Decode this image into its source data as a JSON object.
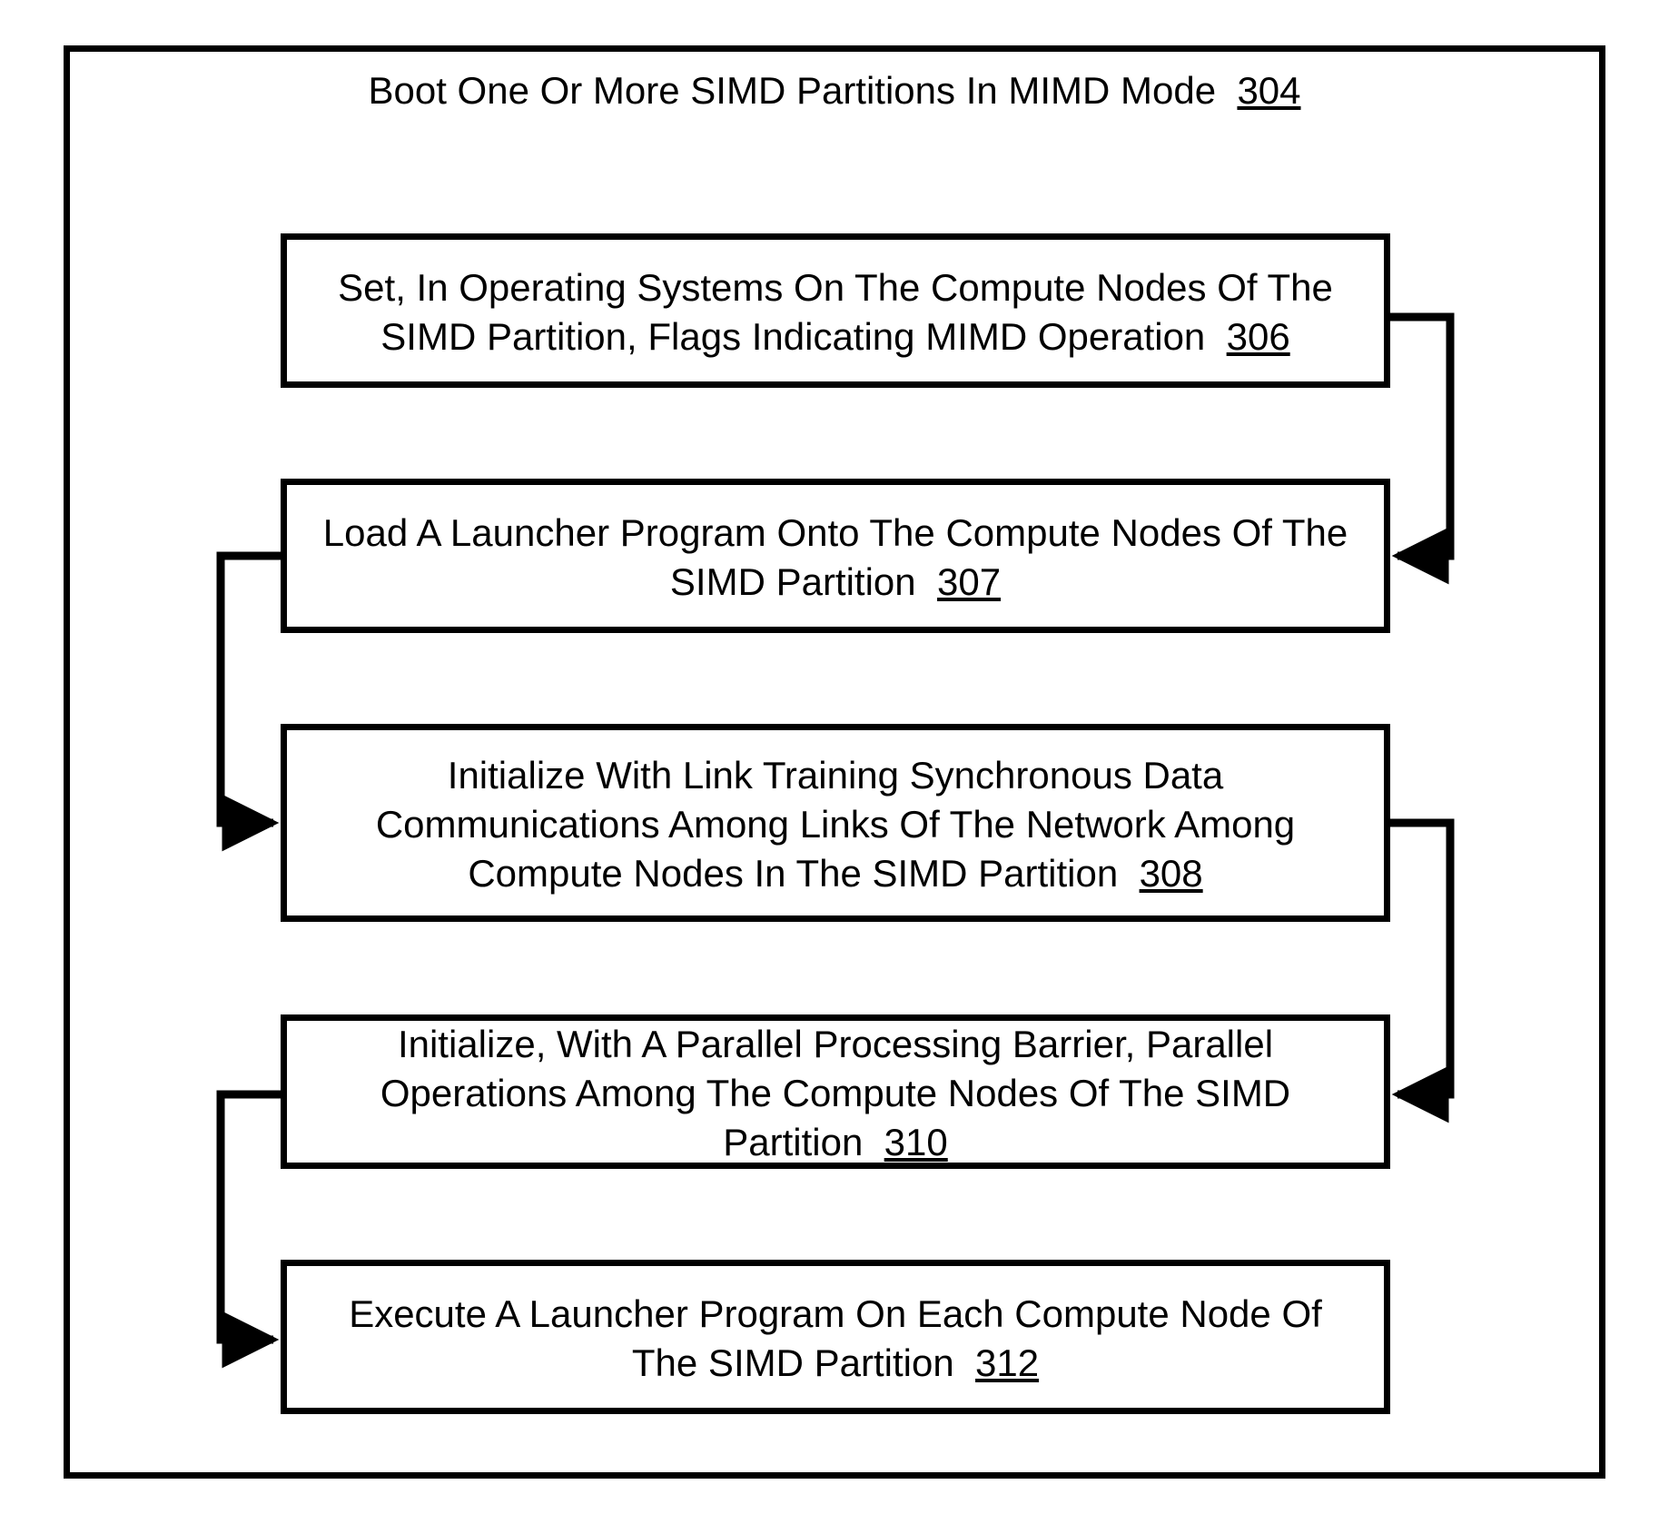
{
  "diagram": {
    "title_text": "Boot One Or More SIMD Partitions In MIMD Mode",
    "title_ref": "304",
    "steps": {
      "s306": {
        "text": "Set, In Operating Systems On The Compute Nodes Of The SIMD Partition, Flags Indicating MIMD Operation",
        "ref": "306"
      },
      "s307": {
        "text": "Load A Launcher Program Onto The Compute Nodes Of The SIMD Partition",
        "ref": "307"
      },
      "s308": {
        "text": "Initialize With Link Training Synchronous Data Communications Among Links Of The Network Among Compute Nodes In The SIMD Partition",
        "ref": "308"
      },
      "s310": {
        "text": "Initialize, With A Parallel Processing Barrier, Parallel Operations Among The Compute Nodes Of The SIMD Partition",
        "ref": "310"
      },
      "s312": {
        "text": "Execute A Launcher Program On Each Compute Node Of The SIMD Partition",
        "ref": "312"
      }
    }
  }
}
